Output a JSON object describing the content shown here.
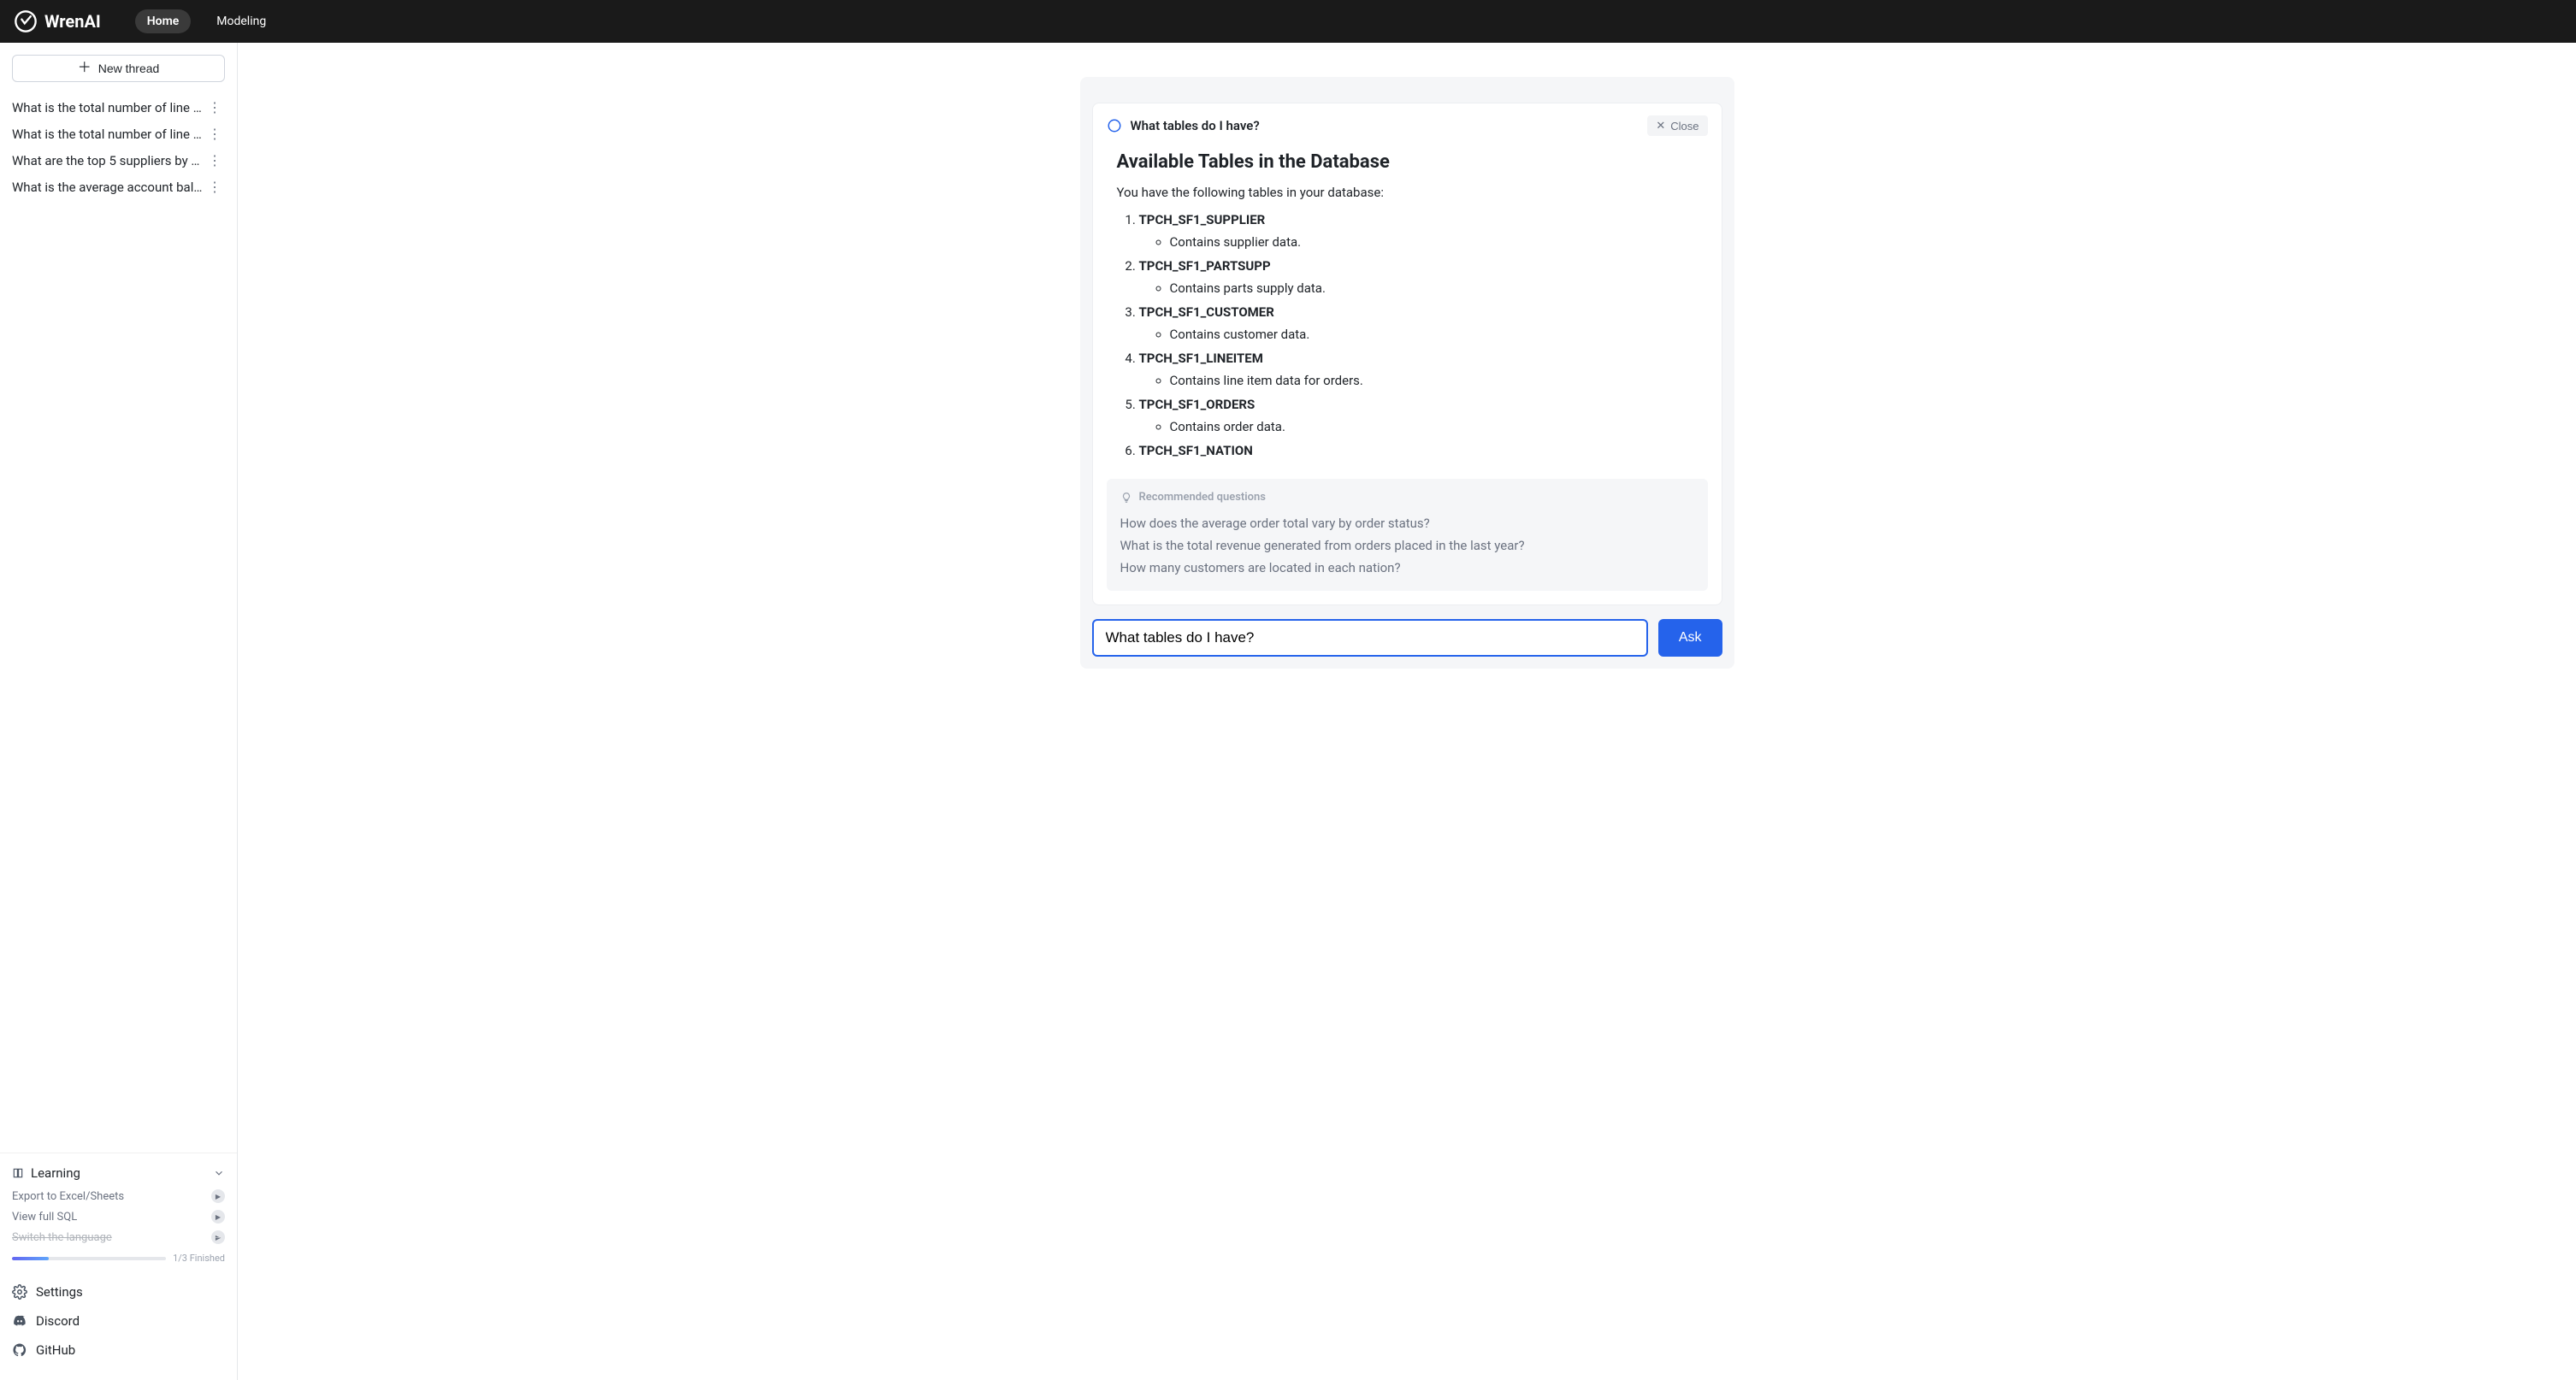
{
  "brand": "WrenAI",
  "nav": {
    "home": "Home",
    "modeling": "Modeling"
  },
  "sidebar": {
    "new_thread": "New thread",
    "threads": [
      "What is the total number of line ite...",
      "What is the total number of line ite...",
      "What are the top 5 suppliers by ac...",
      "What is the average account bala..."
    ],
    "learning": {
      "title": "Learning",
      "items": [
        {
          "label": "Export to Excel/Sheets",
          "done": false
        },
        {
          "label": "View full SQL",
          "done": false
        },
        {
          "label": "Switch the language",
          "done": true
        }
      ],
      "progress_text": "1/3 Finished",
      "progress_pct": 24
    },
    "footer": {
      "settings": "Settings",
      "discord": "Discord",
      "github": "GitHub"
    }
  },
  "chat": {
    "question": "What tables do I have?",
    "close": "Close",
    "title": "Available Tables in the Database",
    "intro": "You have the following tables in your database:",
    "tables": [
      {
        "name": "TPCH_SF1_SUPPLIER",
        "desc": "Contains supplier data."
      },
      {
        "name": "TPCH_SF1_PARTSUPP",
        "desc": "Contains parts supply data."
      },
      {
        "name": "TPCH_SF1_CUSTOMER",
        "desc": "Contains customer data."
      },
      {
        "name": "TPCH_SF1_LINEITEM",
        "desc": "Contains line item data for orders."
      },
      {
        "name": "TPCH_SF1_ORDERS",
        "desc": "Contains order data."
      },
      {
        "name": "TPCH_SF1_NATION",
        "desc": ""
      }
    ],
    "recommended_header": "Recommended questions",
    "recommended": [
      "How does the average order total vary by order status?",
      "What is the total revenue generated from orders placed in the last year?",
      "How many customers are located in each nation?"
    ],
    "input_value": "What tables do I have?",
    "ask_label": "Ask"
  }
}
